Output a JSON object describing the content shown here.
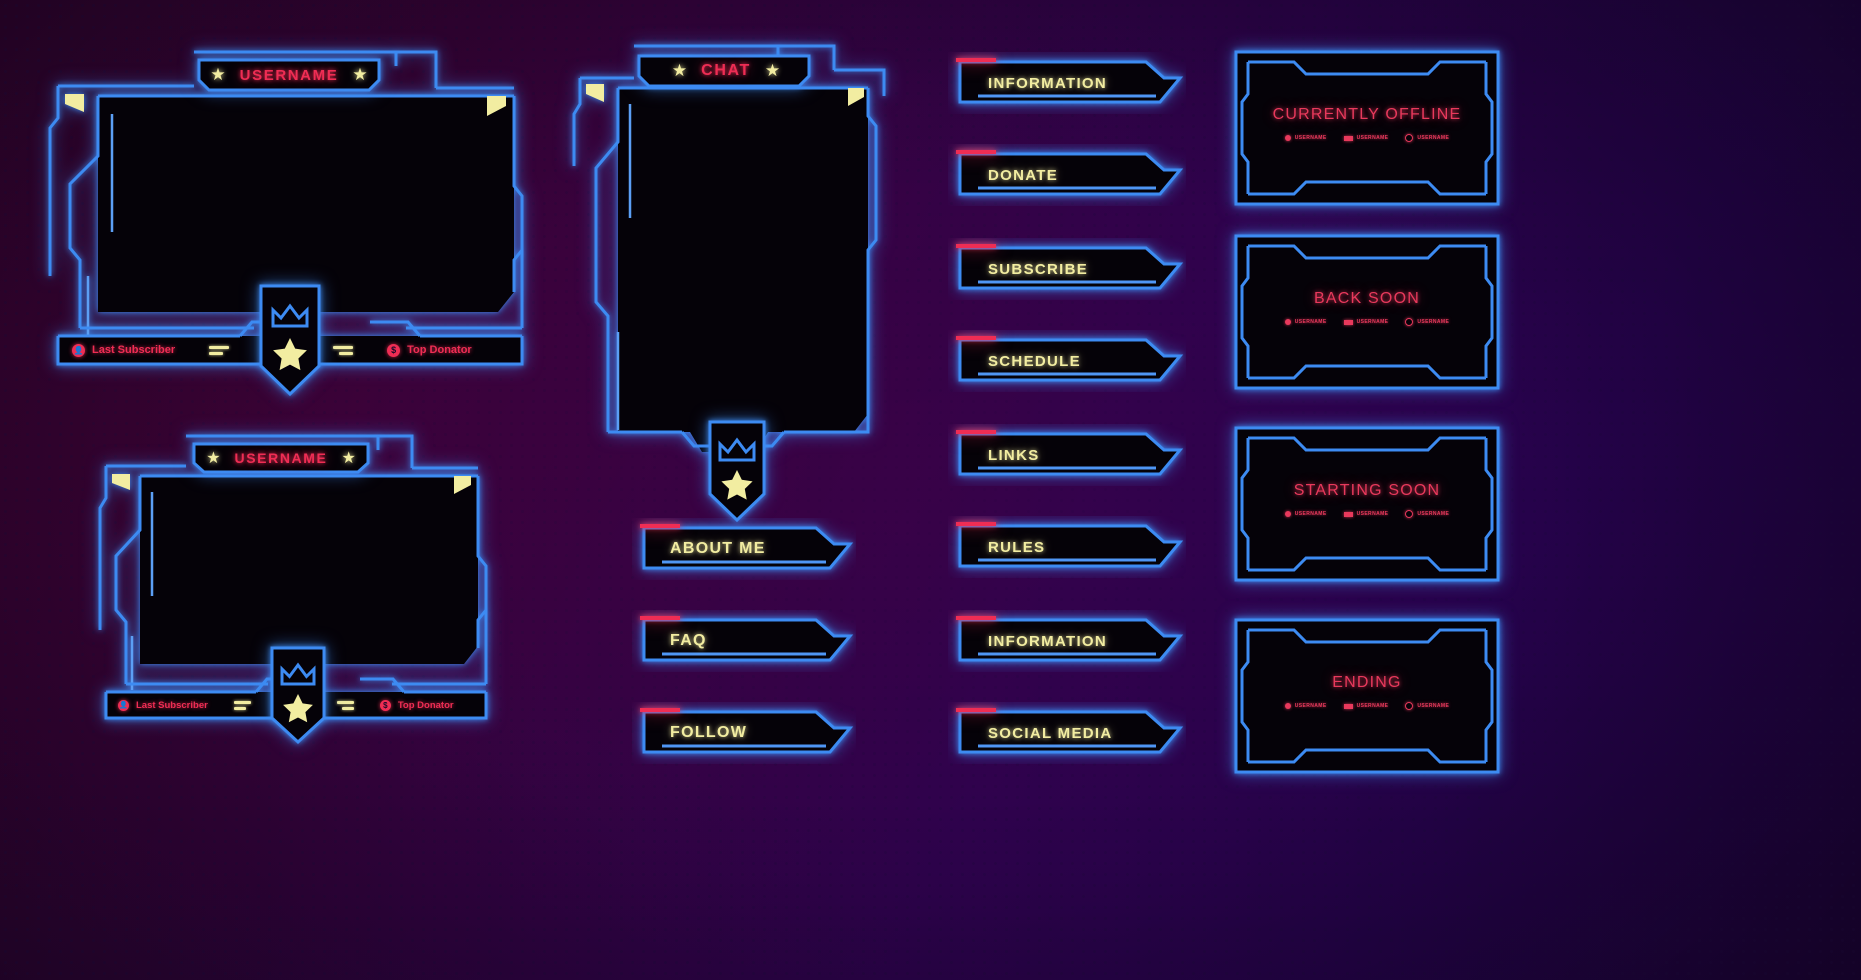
{
  "meta": {
    "theme": "neon-retro-stream-overlay",
    "colors": {
      "neon_blue": "#3d8bf2",
      "neon_red": "#ef2d54",
      "neon_yellow": "#f2eda1",
      "screen_black": "#050208",
      "bg_magenta": "#6d0f3f",
      "bg_purple": "#4a1262"
    }
  },
  "webcam_large": {
    "title": "USERNAME",
    "left_star_icon": "star-icon",
    "right_star_icon": "star-icon",
    "last_subscriber": {
      "icon": "user-icon",
      "label": "Last Subscriber"
    },
    "top_donator": {
      "icon": "dollar-icon",
      "label": "Top Donator"
    },
    "emblem_icon": "crown-shield-icon"
  },
  "webcam_small": {
    "title": "USERNAME",
    "left_star_icon": "star-icon",
    "right_star_icon": "star-icon",
    "last_subscriber": {
      "icon": "user-icon",
      "label": "Last Subscriber"
    },
    "top_donator": {
      "icon": "dollar-icon",
      "label": "Top Donator"
    },
    "emblem_icon": "crown-shield-icon"
  },
  "chat_panel": {
    "title": "CHAT",
    "left_star_icon": "star-icon",
    "right_star_icon": "star-icon",
    "emblem_icon": "crown-shield-icon"
  },
  "menu_column_left": [
    {
      "label": "ABOUT ME"
    },
    {
      "label": "FAQ"
    },
    {
      "label": "FOLLOW"
    }
  ],
  "menu_column_right": [
    {
      "label": "INFORMATION"
    },
    {
      "label": "DONATE"
    },
    {
      "label": "SUBSCRIBE"
    },
    {
      "label": "SCHEDULE"
    },
    {
      "label": "LINKS"
    },
    {
      "label": "RULES"
    },
    {
      "label": "INFORMATION"
    },
    {
      "label": "SOCIAL MEDIA"
    }
  ],
  "status_screens": [
    {
      "title": "CURRENTLY OFFLINE",
      "badges": [
        {
          "icon": "circle-icon",
          "label": "USERNAME"
        },
        {
          "icon": "square-icon",
          "label": "USERNAME"
        },
        {
          "icon": "ring-icon",
          "label": "USERNAME"
        }
      ]
    },
    {
      "title": "BACK SOON",
      "badges": [
        {
          "icon": "circle-icon",
          "label": "USERNAME"
        },
        {
          "icon": "square-icon",
          "label": "USERNAME"
        },
        {
          "icon": "ring-icon",
          "label": "USERNAME"
        }
      ]
    },
    {
      "title": "STARTING SOON",
      "badges": [
        {
          "icon": "circle-icon",
          "label": "USERNAME"
        },
        {
          "icon": "square-icon",
          "label": "USERNAME"
        },
        {
          "icon": "ring-icon",
          "label": "USERNAME"
        }
      ]
    },
    {
      "title": "ENDING",
      "badges": [
        {
          "icon": "circle-icon",
          "label": "USERNAME"
        },
        {
          "icon": "square-icon",
          "label": "USERNAME"
        },
        {
          "icon": "ring-icon",
          "label": "USERNAME"
        }
      ]
    }
  ]
}
